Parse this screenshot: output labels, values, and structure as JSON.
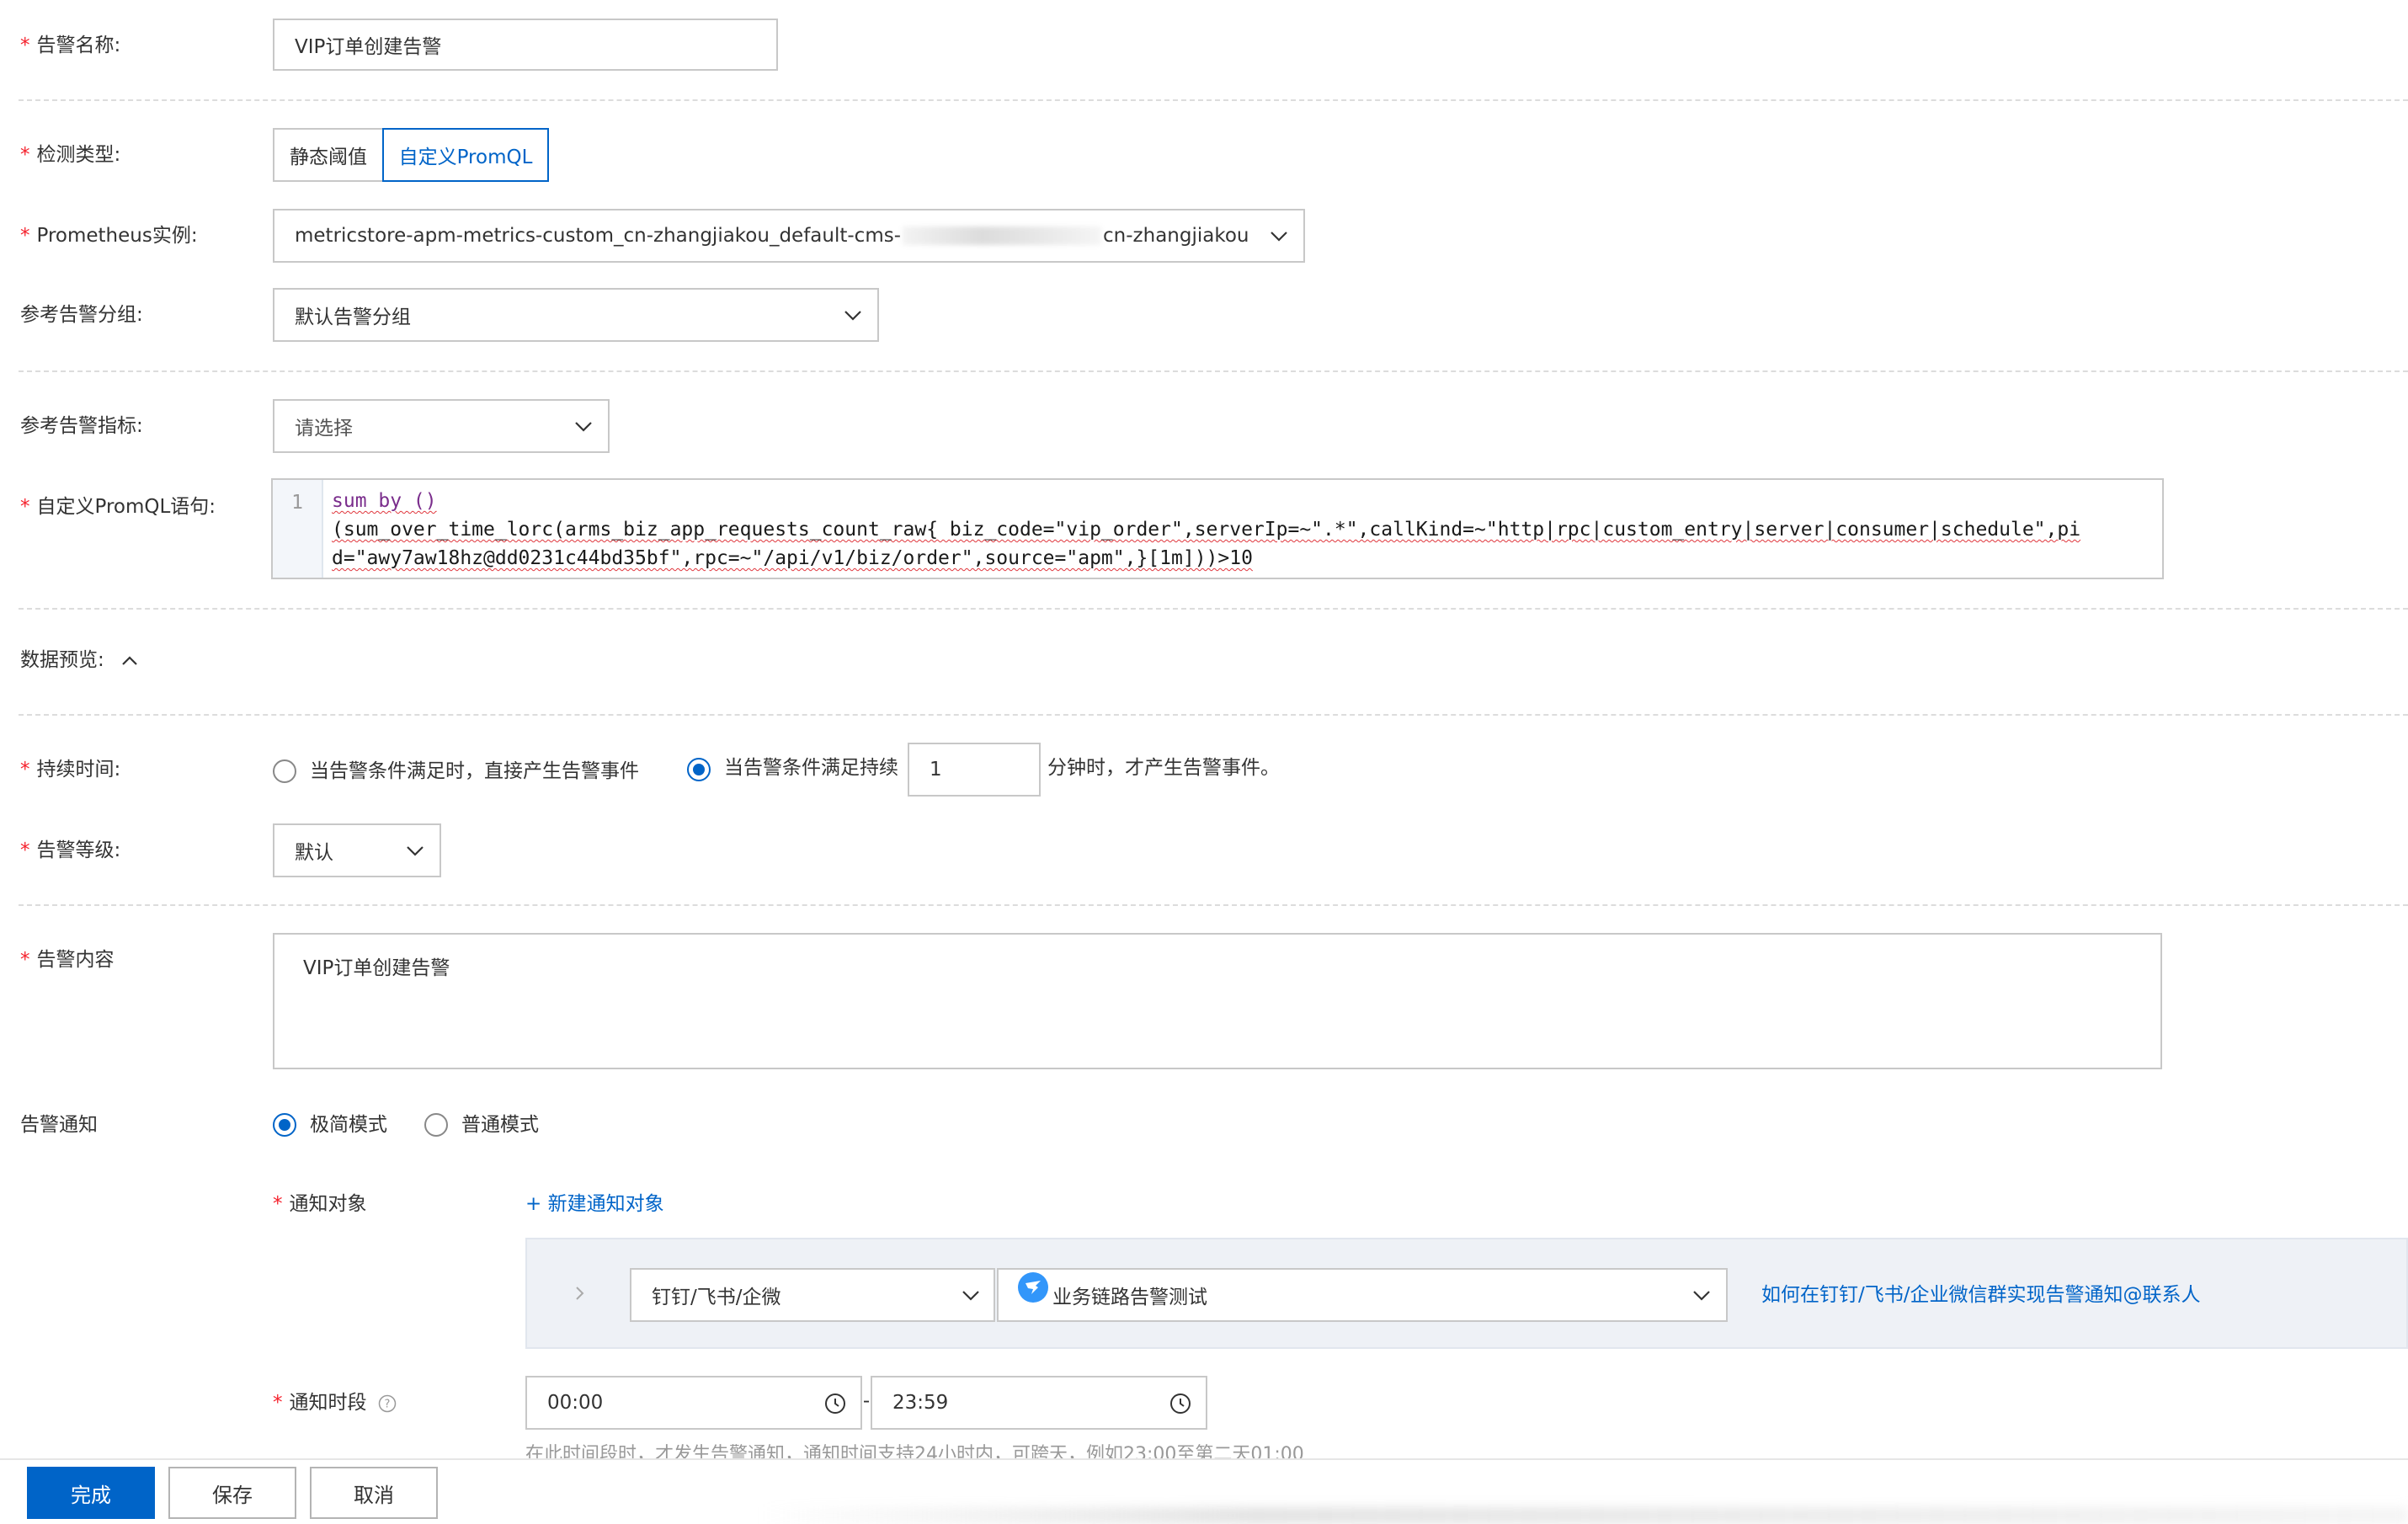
{
  "alert_name": {
    "label": "告警名称:",
    "value": "VIP订单创建告警"
  },
  "detect_type": {
    "label": "检测类型:",
    "options": [
      "静态阈值",
      "自定义PromQL"
    ],
    "selected": "自定义PromQL"
  },
  "prometheus": {
    "label": "Prometheus实例:",
    "value_prefix": "metricstore-apm-metrics-custom_cn-zhangjiakou_default-cms-",
    "value_suffix": "cn-zhangjiakou",
    "chevron_icon": "chevron-down-icon"
  },
  "ref_group": {
    "label": "参考告警分组:",
    "value": "默认告警分组"
  },
  "ref_metric": {
    "label": "参考告警指标:",
    "placeholder": "请选择"
  },
  "promql": {
    "label": "自定义PromQL语句:",
    "line_number": "1",
    "line1": "sum by ()",
    "line2": "(sum_over_time_lorc(arms_biz_app_requests_count_raw{ biz_code=\"vip_order\",serverIp=~\".*\",callKind=~\"http|rpc|custom_entry|server|consumer|schedule\",pi",
    "line3": "d=\"awy7aw18hz@dd0231c44bd35bf\",rpc=~\"/api/v1/biz/order\",source=\"apm\",}[1m]))>10"
  },
  "data_preview": {
    "label": "数据预览:",
    "icon": "chevron-up-icon"
  },
  "duration": {
    "label": "持续时间:",
    "option1": "当告警条件满足时，直接产生告警事件",
    "option2": "当告警条件满足持续",
    "minutes": "1",
    "suffix": "分钟时，才产生告警事件。",
    "selected": 2
  },
  "alert_level": {
    "label": "告警等级:",
    "value": "默认"
  },
  "alert_content": {
    "label": "告警内容",
    "value": "VIP订单创建告警"
  },
  "notify": {
    "label": "告警通知",
    "mode1": "极简模式",
    "mode2": "普通模式",
    "selected": 1
  },
  "notify_target": {
    "label": "通知对象",
    "new_link": "+ 新建通知对象",
    "channel": "钉钉/飞书/企微",
    "group": "业务链路告警测试",
    "help_link": "如何在钉钉/飞书/企业微信群实现告警通知@联系人"
  },
  "notify_period": {
    "label": "通知时段",
    "start": "00:00",
    "end": "23:59",
    "separator": "-",
    "hint": "在此时间段时，才发生告警通知，通知时间支持24小时内，可跨天，例如23:00至第二天01:00"
  },
  "footer": {
    "done": "完成",
    "save": "保存",
    "cancel": "取消"
  },
  "colors": {
    "primary": "#0064c8",
    "required": "#f5222d",
    "border": "#c8c8c8"
  }
}
